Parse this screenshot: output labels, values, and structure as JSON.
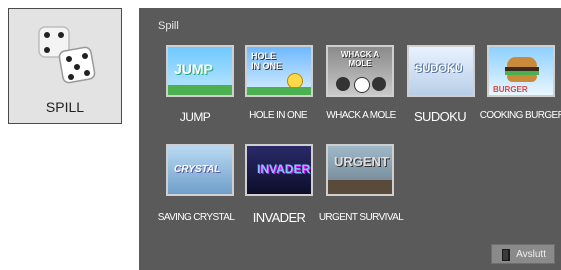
{
  "app_tile": {
    "label": "SPILL",
    "icon": "dice-icon"
  },
  "panel": {
    "title": "Spill"
  },
  "games": [
    {
      "label": "JUMP",
      "thumb_text": "JUMP"
    },
    {
      "label": "HOLE IN ONE",
      "thumb_text": "HOLE IN ONE"
    },
    {
      "label": "WHACK A MOLE",
      "thumb_text": "WHACK A MOLE"
    },
    {
      "label": "SUDOKU",
      "thumb_text": "SUDOKU"
    },
    {
      "label": "COOKING BURGER",
      "thumb_text": "BURGER"
    },
    {
      "label": "SAVING CRYSTAL",
      "thumb_text": "CRYSTAL"
    },
    {
      "label": "INVADER",
      "thumb_text": "INVADER"
    },
    {
      "label": "URGENT SURVIVAL",
      "thumb_text": "URGENT"
    }
  ],
  "exit_button": {
    "label": "Avslutt",
    "icon": "door-exit-icon"
  }
}
